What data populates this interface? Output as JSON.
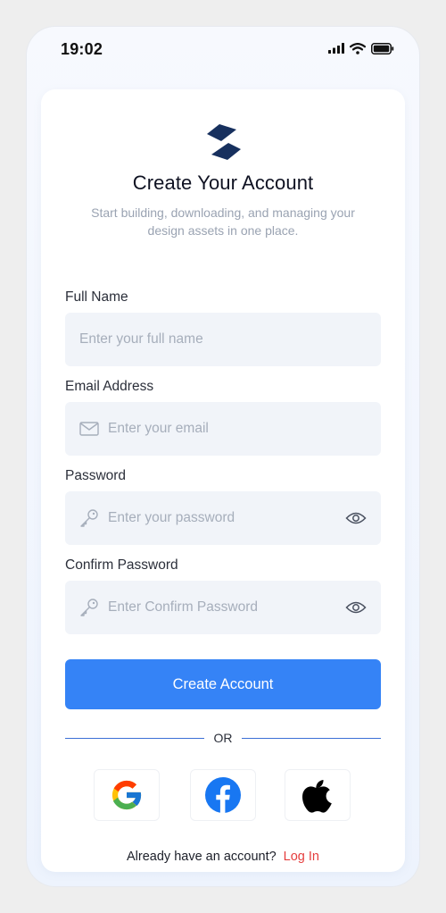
{
  "status_bar": {
    "time": "19:02",
    "icons": [
      "signal-icon",
      "wifi-icon",
      "battery-icon"
    ]
  },
  "header": {
    "logo_icon": "brand-logo-icon",
    "title": "Create Your Account",
    "subtitle": "Start building, downloading, and managing your design assets in one place."
  },
  "form": {
    "full_name": {
      "label": "Full Name",
      "placeholder": "Enter your full name",
      "value": ""
    },
    "email": {
      "label": "Email Address",
      "placeholder": "Enter your email",
      "value": "",
      "icon": "mail-icon"
    },
    "password": {
      "label": "Password",
      "placeholder": "Enter your password",
      "value": "",
      "icon": "key-icon",
      "toggle_icon": "eye-icon"
    },
    "confirm_password": {
      "label": "Confirm Password",
      "placeholder": "Enter Confirm Password",
      "value": "",
      "icon": "key-icon",
      "toggle_icon": "eye-icon"
    },
    "submit_label": "Create Account"
  },
  "divider": {
    "text": "OR"
  },
  "social": [
    {
      "name": "Google",
      "icon": "google-icon"
    },
    {
      "name": "Facebook",
      "icon": "facebook-icon"
    },
    {
      "name": "Apple",
      "icon": "apple-icon"
    }
  ],
  "footer": {
    "prompt": "Already have an account?",
    "link": "Log In"
  },
  "colors": {
    "primary": "#3583f6",
    "link": "#e53e3e",
    "brand_dark": "#17305e",
    "field_bg": "#f1f4f9",
    "placeholder": "#a6aebb"
  }
}
